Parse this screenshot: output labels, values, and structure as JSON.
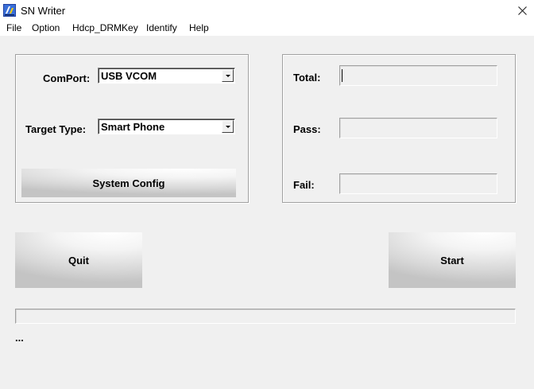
{
  "window": {
    "title": "SN Writer",
    "icon": "sn-writer-app-icon",
    "close_icon": "close-icon"
  },
  "menu": {
    "items": [
      "File",
      "Option",
      "Hdcp_DRMKey",
      "Identify",
      "Help"
    ]
  },
  "config": {
    "comport_label": "ComPort:",
    "comport_value": "USB VCOM",
    "target_type_label": "Target Type:",
    "target_type_value": "Smart Phone",
    "system_config_button": "System Config"
  },
  "counters": {
    "total_label": "Total:",
    "total_value": "",
    "pass_label": "Pass:",
    "pass_value": "",
    "fail_label": "Fail:",
    "fail_value": ""
  },
  "actions": {
    "quit_label": "Quit",
    "start_label": "Start"
  },
  "progress": {
    "percent": 0
  },
  "status": {
    "text": "..."
  }
}
